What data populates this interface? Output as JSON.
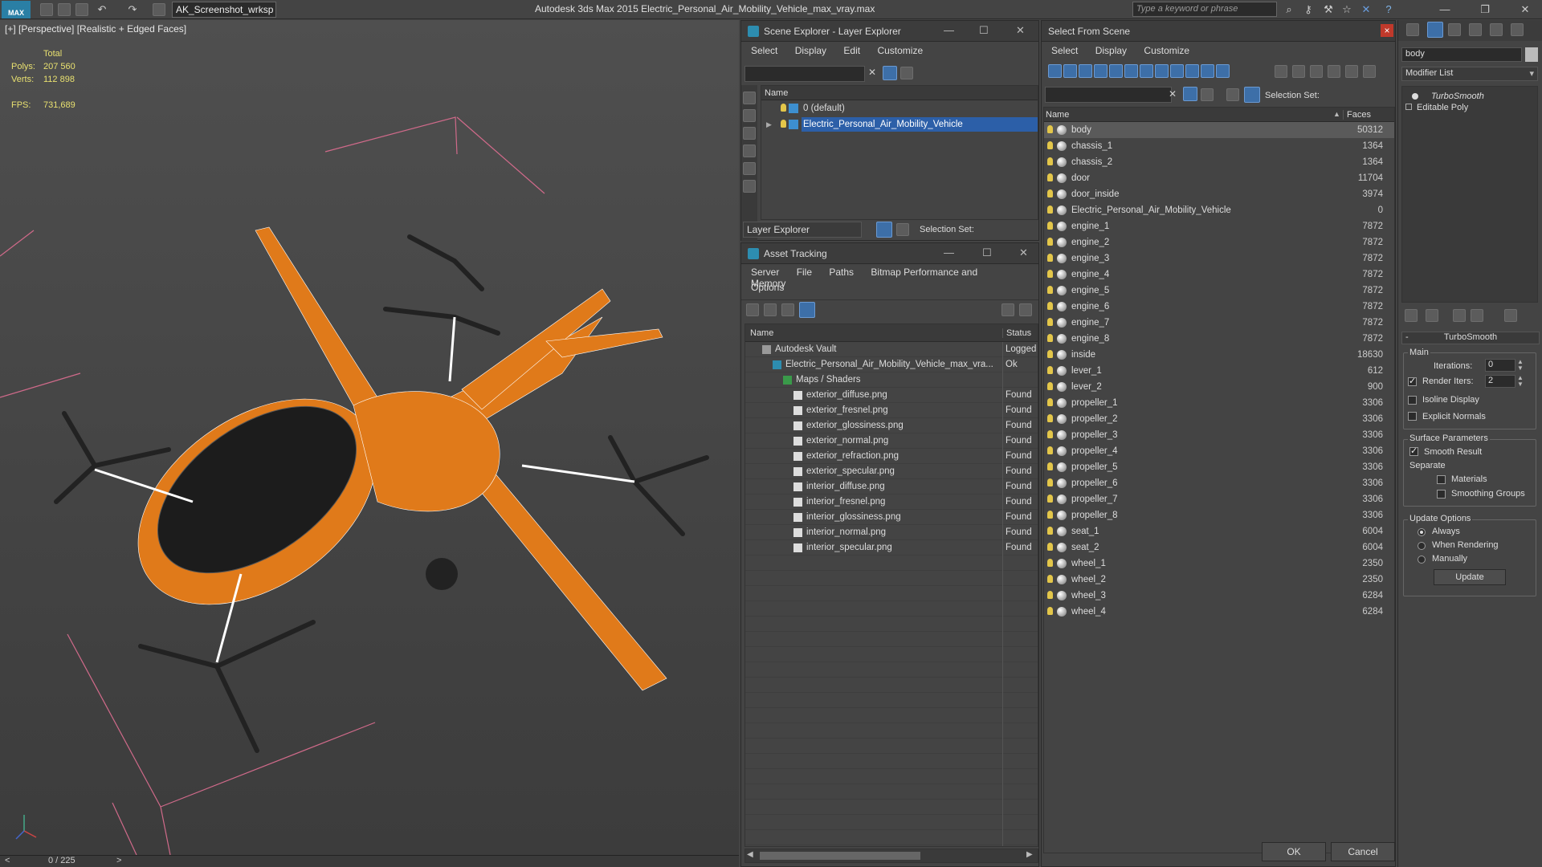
{
  "app": {
    "title": "Autodesk 3ds Max  2015     Electric_Personal_Air_Mobility_Vehicle_max_vray.max",
    "workspace": "AK_Screenshot_wrksp",
    "search_placeholder": "Type a keyword or phrase",
    "logo": "MAX"
  },
  "viewport": {
    "label": "[+] [Perspective] [Realistic + Edged Faces]",
    "stats": {
      "total_label": "Total",
      "polys_label": "Polys:",
      "polys": "207 560",
      "verts_label": "Verts:",
      "verts": "112 898",
      "fps_label": "FPS:",
      "fps": "731,689"
    },
    "timeline": "0 / 225"
  },
  "scene_explorer": {
    "title": "Scene Explorer - Layer Explorer",
    "menu": [
      "Select",
      "Display",
      "Edit",
      "Customize"
    ],
    "col_name": "Name",
    "layers": [
      {
        "name": "0 (default)",
        "selected": false
      },
      {
        "name": "Electric_Personal_Air_Mobility_Vehicle",
        "selected": true
      }
    ],
    "footer_label": "Layer Explorer",
    "selection_set_label": "Selection Set:"
  },
  "asset_tracking": {
    "title": "Asset Tracking",
    "menu": [
      "Server",
      "File",
      "Paths",
      "Bitmap Performance and Memory"
    ],
    "menu2": "Options",
    "col_name": "Name",
    "col_status": "Status",
    "rows": [
      {
        "name": "Autodesk Vault",
        "status": "Logged",
        "indent": 1
      },
      {
        "name": "Electric_Personal_Air_Mobility_Vehicle_max_vra...",
        "status": "Ok",
        "indent": 2
      },
      {
        "name": "Maps / Shaders",
        "status": "",
        "indent": 3
      },
      {
        "name": "exterior_diffuse.png",
        "status": "Found",
        "indent": 4
      },
      {
        "name": "exterior_fresnel.png",
        "status": "Found",
        "indent": 4
      },
      {
        "name": "exterior_glossiness.png",
        "status": "Found",
        "indent": 4
      },
      {
        "name": "exterior_normal.png",
        "status": "Found",
        "indent": 4
      },
      {
        "name": "exterior_refraction.png",
        "status": "Found",
        "indent": 4
      },
      {
        "name": "exterior_specular.png",
        "status": "Found",
        "indent": 4
      },
      {
        "name": "interior_diffuse.png",
        "status": "Found",
        "indent": 4
      },
      {
        "name": "interior_fresnel.png",
        "status": "Found",
        "indent": 4
      },
      {
        "name": "interior_glossiness.png",
        "status": "Found",
        "indent": 4
      },
      {
        "name": "interior_normal.png",
        "status": "Found",
        "indent": 4
      },
      {
        "name": "interior_specular.png",
        "status": "Found",
        "indent": 4
      }
    ]
  },
  "select_from_scene": {
    "title": "Select From Scene",
    "menu": [
      "Select",
      "Display",
      "Customize"
    ],
    "selection_set_label": "Selection Set:",
    "col_name": "Name",
    "col_faces": "Faces",
    "ok": "OK",
    "cancel": "Cancel",
    "objects": [
      {
        "name": "body",
        "faces": "50312",
        "selected": true
      },
      {
        "name": "chassis_1",
        "faces": "1364"
      },
      {
        "name": "chassis_2",
        "faces": "1364"
      },
      {
        "name": "door",
        "faces": "11704"
      },
      {
        "name": "door_inside",
        "faces": "3974"
      },
      {
        "name": "Electric_Personal_Air_Mobility_Vehicle",
        "faces": "0"
      },
      {
        "name": "engine_1",
        "faces": "7872"
      },
      {
        "name": "engine_2",
        "faces": "7872"
      },
      {
        "name": "engine_3",
        "faces": "7872"
      },
      {
        "name": "engine_4",
        "faces": "7872"
      },
      {
        "name": "engine_5",
        "faces": "7872"
      },
      {
        "name": "engine_6",
        "faces": "7872"
      },
      {
        "name": "engine_7",
        "faces": "7872"
      },
      {
        "name": "engine_8",
        "faces": "7872"
      },
      {
        "name": "inside",
        "faces": "18630"
      },
      {
        "name": "lever_1",
        "faces": "612"
      },
      {
        "name": "lever_2",
        "faces": "900"
      },
      {
        "name": "propeller_1",
        "faces": "3306"
      },
      {
        "name": "propeller_2",
        "faces": "3306"
      },
      {
        "name": "propeller_3",
        "faces": "3306"
      },
      {
        "name": "propeller_4",
        "faces": "3306"
      },
      {
        "name": "propeller_5",
        "faces": "3306"
      },
      {
        "name": "propeller_6",
        "faces": "3306"
      },
      {
        "name": "propeller_7",
        "faces": "3306"
      },
      {
        "name": "propeller_8",
        "faces": "3306"
      },
      {
        "name": "seat_1",
        "faces": "6004"
      },
      {
        "name": "seat_2",
        "faces": "6004"
      },
      {
        "name": "wheel_1",
        "faces": "2350"
      },
      {
        "name": "wheel_2",
        "faces": "2350"
      },
      {
        "name": "wheel_3",
        "faces": "6284"
      },
      {
        "name": "wheel_4",
        "faces": "6284"
      }
    ]
  },
  "modifier_panel": {
    "object_name": "body",
    "modifier_list": "Modifier List",
    "stack": [
      "TurboSmooth",
      "Editable Poly"
    ],
    "rollout_title": "TurboSmooth",
    "main_label": "Main",
    "iterations_label": "Iterations:",
    "iterations": "0",
    "render_iters_label": "Render Iters:",
    "render_iters": "2",
    "isoline": "Isoline Display",
    "explicit_normals": "Explicit Normals",
    "surface_params": "Surface Parameters",
    "smooth_result": "Smooth Result",
    "separate": "Separate",
    "materials": "Materials",
    "smoothing_groups": "Smoothing Groups",
    "update_options": "Update Options",
    "always": "Always",
    "when_rendering": "When Rendering",
    "manually": "Manually",
    "update_btn": "Update"
  },
  "colors": {
    "accent": "#3d6fa8",
    "selection": "#2c5fa8",
    "model_orange": "#e07a1a"
  }
}
